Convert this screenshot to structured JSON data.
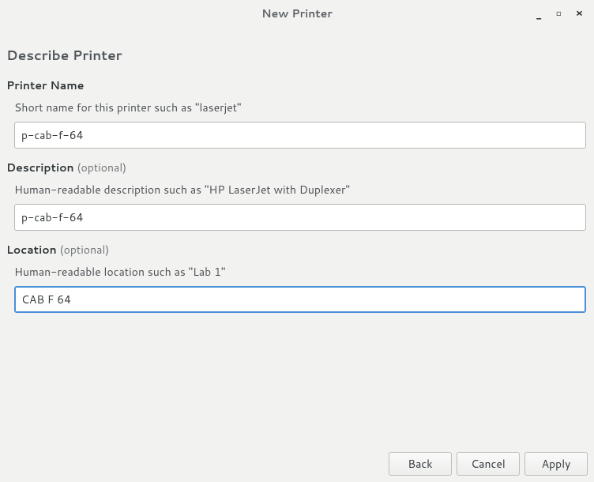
{
  "window": {
    "title": "New Printer"
  },
  "header": "Describe Printer",
  "fields": {
    "name": {
      "label": "Printer Name",
      "hint": "Short name for this printer such as \"laserjet\"",
      "value": "p-cab-f-64"
    },
    "description": {
      "label": "Description",
      "optional": "(optional)",
      "hint": "Human-readable description such as \"HP LaserJet with Duplexer\"",
      "value": "p-cab-f-64"
    },
    "location": {
      "label": "Location",
      "optional": "(optional)",
      "hint": "Human-readable location such as \"Lab 1\"",
      "value": "CAB F 64"
    }
  },
  "buttons": {
    "back": "Back",
    "cancel": "Cancel",
    "apply": "Apply"
  }
}
